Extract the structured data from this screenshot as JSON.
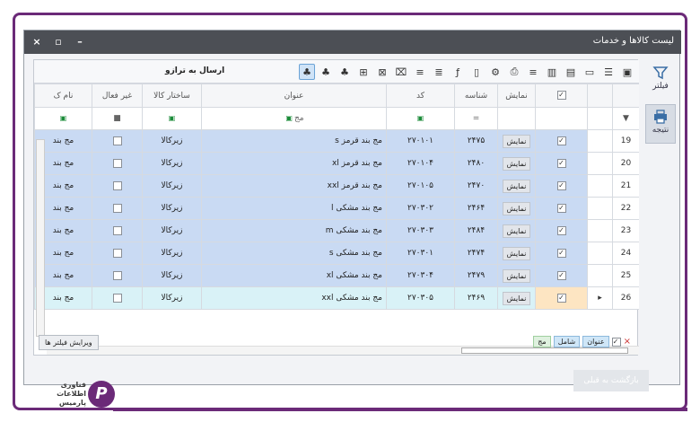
{
  "window": {
    "title": "لیست کالاها و خدمات",
    "controls": [
      "×",
      "▫",
      "–"
    ]
  },
  "sidepanel": {
    "filter_label": "فیلتر",
    "result_label": "نتیجه"
  },
  "toolbar": {
    "send_label": "ارسال به ترازو",
    "icons": [
      "contact-icon",
      "list-icon",
      "window-icon",
      "save-icon",
      "save-as-icon",
      "align-icon",
      "print-icon",
      "settings-icon",
      "document-icon",
      "function-icon",
      "text-align-icon",
      "text-align-2-icon",
      "excel-delete-icon",
      "excel-icon",
      "excel-2-icon",
      "tree-icon",
      "tree-add-icon",
      "tree-send-icon"
    ]
  },
  "grid": {
    "columns": [
      "",
      "",
      "نمایش",
      "شناسه",
      "کد",
      "عنوان",
      "ساختار کالا",
      "غیر فعال",
      "نام ک"
    ],
    "filter_row": {
      "title_filter": "مج",
      "code_filter": "=",
      "inactive_filter": "■"
    },
    "rows": [
      {
        "num": "19",
        "show": "نمایش",
        "id": "۲۴۷۵",
        "code": "۲۷۰۱۰۱",
        "title": "مج بند قرمز s",
        "structure": "زیرکالا",
        "name": "مج بند",
        "checked": "✓"
      },
      {
        "num": "20",
        "show": "نمایش",
        "id": "۲۴۸۰",
        "code": "۲۷۰۱۰۴",
        "title": "مج بند قرمز xl",
        "structure": "زیرکالا",
        "name": "مج بند",
        "checked": "✓"
      },
      {
        "num": "21",
        "show": "نمایش",
        "id": "۲۴۷۰",
        "code": "۲۷۰۱۰۵",
        "title": "مج بند قرمز xxl",
        "structure": "زیرکالا",
        "name": "مج بند",
        "checked": "✓"
      },
      {
        "num": "22",
        "show": "نمایش",
        "id": "۲۴۶۴",
        "code": "۲۷۰۳۰۲",
        "title": "مج بند مشکی l",
        "structure": "زیرکالا",
        "name": "مج بند",
        "checked": "✓"
      },
      {
        "num": "23",
        "show": "نمایش",
        "id": "۲۴۸۴",
        "code": "۲۷۰۳۰۳",
        "title": "مج بند مشکی m",
        "structure": "زیرکالا",
        "name": "مج بند",
        "checked": "✓"
      },
      {
        "num": "24",
        "show": "نمایش",
        "id": "۲۴۷۴",
        "code": "۲۷۰۳۰۱",
        "title": "مج بند مشکی s",
        "structure": "زیرکالا",
        "name": "مج بند",
        "checked": "✓"
      },
      {
        "num": "25",
        "show": "نمایش",
        "id": "۲۴۷۹",
        "code": "۲۷۰۳۰۴",
        "title": "مج بند مشکی xl",
        "structure": "زیرکالا",
        "name": "مج بند",
        "checked": "✓"
      },
      {
        "num": "26",
        "show": "نمایش",
        "id": "۲۴۶۹",
        "code": "۲۷۰۳۰۵",
        "title": "مج بند مشکی xxl",
        "structure": "زیرکالا",
        "name": "مج بند",
        "checked": "✓"
      }
    ]
  },
  "bottombar": {
    "edit_filters_label": "ویرایش فیلتر ها",
    "chip_title": "عنوان",
    "chip_contains": "شامل",
    "chip_value": "مج",
    "check_mark": "✓",
    "clear_mark": "×"
  },
  "return_button": "بازگشت به قبلی",
  "logo": {
    "line1": "فناوری",
    "line2": "اطلاعات",
    "line3": "پارمیس",
    "mark": "P"
  },
  "colors": {
    "frame": "#6b2a78",
    "titlebar": "#4c4f55",
    "row_selected": "#c9daf3",
    "row_current": "#d9f2f7"
  }
}
